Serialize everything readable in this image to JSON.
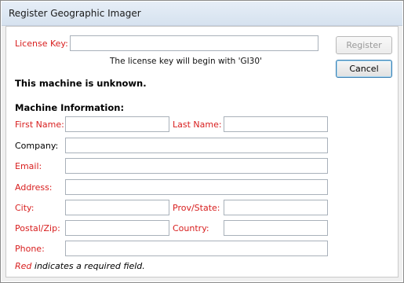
{
  "window": {
    "title": "Register Geographic Imager"
  },
  "license": {
    "label": "License Key:",
    "value": "",
    "hint": "The license key will begin with 'GI30'"
  },
  "buttons": {
    "register": "Register",
    "cancel": "Cancel"
  },
  "status": {
    "machine_unknown": "This machine is unknown."
  },
  "machine_info": {
    "heading": "Machine Information:",
    "first_name": {
      "label": "First Name:",
      "value": ""
    },
    "last_name": {
      "label": "Last Name:",
      "value": ""
    },
    "company": {
      "label": "Company:",
      "value": ""
    },
    "email": {
      "label": "Email:",
      "value": ""
    },
    "address": {
      "label": "Address:",
      "value": ""
    },
    "city": {
      "label": "City:",
      "value": ""
    },
    "prov_state": {
      "label": "Prov/State:",
      "value": ""
    },
    "postal_zip": {
      "label": "Postal/Zip:",
      "value": ""
    },
    "country": {
      "label": "Country:",
      "value": ""
    },
    "phone": {
      "label": "Phone:",
      "value": ""
    }
  },
  "footer": {
    "red_word": "Red",
    "rest": " indicates a required field."
  },
  "colors": {
    "required": "#d81e1e",
    "panel_bg": "#ffffff",
    "window_bg": "#f0f0f0"
  }
}
